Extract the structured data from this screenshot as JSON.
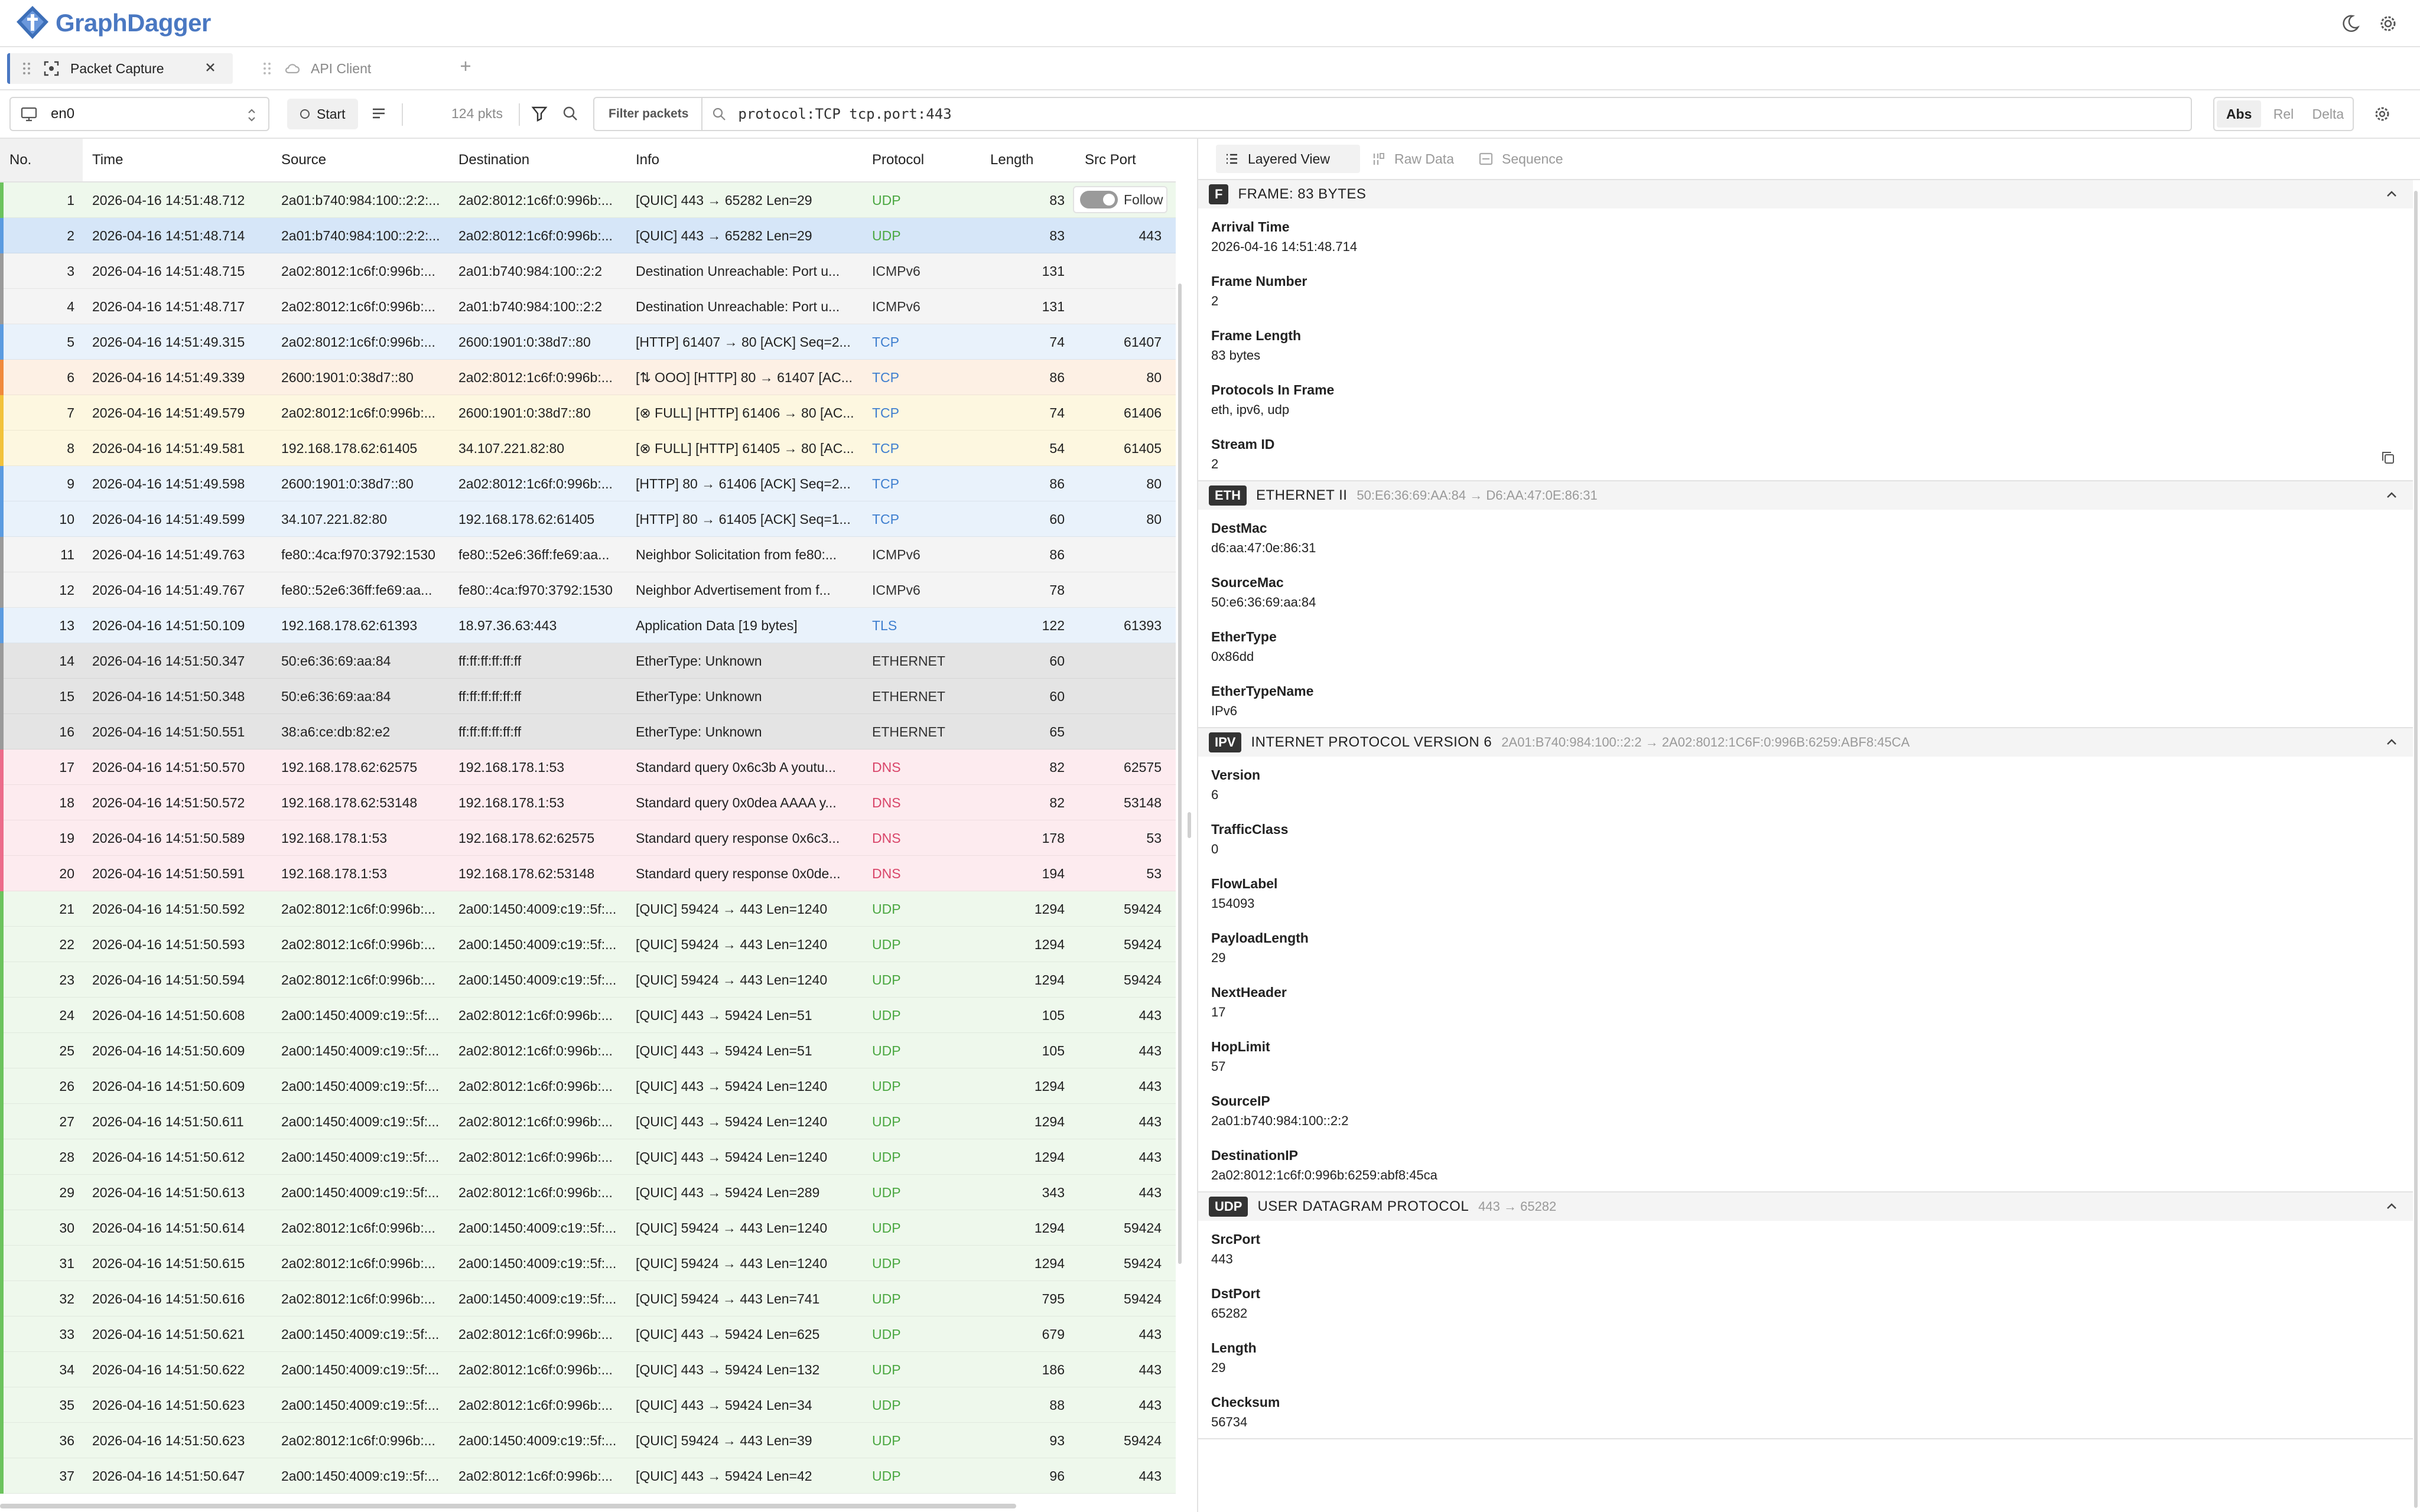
{
  "app": {
    "name": "GraphDagger"
  },
  "tabs": [
    {
      "label": "Packet Capture",
      "active": true
    },
    {
      "label": "API Client",
      "active": false
    }
  ],
  "toolbar": {
    "interface": "en0",
    "start_label": "Start",
    "packet_count": "124 pkts",
    "filter_label": "Filter packets",
    "filter_value": "protocol:TCP tcp.port:443",
    "time_modes": [
      "Abs",
      "Rel",
      "Delta"
    ],
    "time_mode_selected": "Abs"
  },
  "table": {
    "columns": {
      "no": "No.",
      "time": "Time",
      "source": "Source",
      "destination": "Destination",
      "info": "Info",
      "protocol": "Protocol",
      "length": "Length",
      "src_port": "Src Port"
    },
    "follow_label": "Follow",
    "rows": [
      {
        "no": "1",
        "time": "2026-04-16 14:51:48.712",
        "src": "2a01:b740:984:100::2:2:...",
        "dst": "2a02:8012:1c6f:0:996b:...",
        "info": "[QUIC] 443 → 65282 Len=29",
        "proto": "UDP",
        "len": "83",
        "port": "",
        "t": "udp"
      },
      {
        "no": "2",
        "time": "2026-04-16 14:51:48.714",
        "src": "2a01:b740:984:100::2:2:...",
        "dst": "2a02:8012:1c6f:0:996b:...",
        "info": "[QUIC] 443 → 65282 Len=29",
        "proto": "UDP",
        "len": "83",
        "port": "443",
        "t": "udp",
        "sel": true
      },
      {
        "no": "3",
        "time": "2026-04-16 14:51:48.715",
        "src": "2a02:8012:1c6f:0:996b:...",
        "dst": "2a01:b740:984:100::2:2",
        "info": "Destination Unreachable: Port u...",
        "proto": "ICMPv6",
        "len": "131",
        "port": "",
        "t": "icmp"
      },
      {
        "no": "4",
        "time": "2026-04-16 14:51:48.717",
        "src": "2a02:8012:1c6f:0:996b:...",
        "dst": "2a01:b740:984:100::2:2",
        "info": "Destination Unreachable: Port u...",
        "proto": "ICMPv6",
        "len": "131",
        "port": "",
        "t": "icmp"
      },
      {
        "no": "5",
        "time": "2026-04-16 14:51:49.315",
        "src": "2a02:8012:1c6f:0:996b:...",
        "dst": "2600:1901:0:38d7::80",
        "info": "[HTTP] 61407 → 80 [ACK] Seq=2...",
        "proto": "TCP",
        "len": "74",
        "port": "61407",
        "t": "tcp"
      },
      {
        "no": "6",
        "time": "2026-04-16 14:51:49.339",
        "src": "2600:1901:0:38d7::80",
        "dst": "2a02:8012:1c6f:0:996b:...",
        "info": "[⇅ OOO] [HTTP] 80 → 61407 [AC...",
        "proto": "TCP",
        "len": "86",
        "port": "80",
        "t": "ooo"
      },
      {
        "no": "7",
        "time": "2026-04-16 14:51:49.579",
        "src": "2a02:8012:1c6f:0:996b:...",
        "dst": "2600:1901:0:38d7::80",
        "info": "[⊗ FULL] [HTTP] 61406 → 80 [AC...",
        "proto": "TCP",
        "len": "74",
        "port": "61406",
        "t": "full"
      },
      {
        "no": "8",
        "time": "2026-04-16 14:51:49.581",
        "src": "192.168.178.62:61405",
        "dst": "34.107.221.82:80",
        "info": "[⊗ FULL] [HTTP] 61405 → 80 [AC...",
        "proto": "TCP",
        "len": "54",
        "port": "61405",
        "t": "full"
      },
      {
        "no": "9",
        "time": "2026-04-16 14:51:49.598",
        "src": "2600:1901:0:38d7::80",
        "dst": "2a02:8012:1c6f:0:996b:...",
        "info": "[HTTP] 80 → 61406 [ACK] Seq=2...",
        "proto": "TCP",
        "len": "86",
        "port": "80",
        "t": "tcp"
      },
      {
        "no": "10",
        "time": "2026-04-16 14:51:49.599",
        "src": "34.107.221.82:80",
        "dst": "192.168.178.62:61405",
        "info": "[HTTP] 80 → 61405 [ACK] Seq=1...",
        "proto": "TCP",
        "len": "60",
        "port": "80",
        "t": "tcp"
      },
      {
        "no": "11",
        "time": "2026-04-16 14:51:49.763",
        "src": "fe80::4ca:f970:3792:1530",
        "dst": "fe80::52e6:36ff:fe69:aa...",
        "info": "Neighbor Solicitation from fe80:...",
        "proto": "ICMPv6",
        "len": "86",
        "port": "",
        "t": "icmp"
      },
      {
        "no": "12",
        "time": "2026-04-16 14:51:49.767",
        "src": "fe80::52e6:36ff:fe69:aa...",
        "dst": "fe80::4ca:f970:3792:1530",
        "info": "Neighbor Advertisement from f...",
        "proto": "ICMPv6",
        "len": "78",
        "port": "",
        "t": "icmp"
      },
      {
        "no": "13",
        "time": "2026-04-16 14:51:50.109",
        "src": "192.168.178.62:61393",
        "dst": "18.97.36.63:443",
        "info": "Application Data [19 bytes]",
        "proto": "TLS",
        "len": "122",
        "port": "61393",
        "t": "tls"
      },
      {
        "no": "14",
        "time": "2026-04-16 14:51:50.347",
        "src": "50:e6:36:69:aa:84",
        "dst": "ff:ff:ff:ff:ff:ff",
        "info": "EtherType: Unknown",
        "proto": "ETHERNET",
        "len": "60",
        "port": "",
        "t": "eth"
      },
      {
        "no": "15",
        "time": "2026-04-16 14:51:50.348",
        "src": "50:e6:36:69:aa:84",
        "dst": "ff:ff:ff:ff:ff:ff",
        "info": "EtherType: Unknown",
        "proto": "ETHERNET",
        "len": "60",
        "port": "",
        "t": "eth"
      },
      {
        "no": "16",
        "time": "2026-04-16 14:51:50.551",
        "src": "38:a6:ce:db:82:e2",
        "dst": "ff:ff:ff:ff:ff:ff",
        "info": "EtherType: Unknown",
        "proto": "ETHERNET",
        "len": "65",
        "port": "",
        "t": "eth"
      },
      {
        "no": "17",
        "time": "2026-04-16 14:51:50.570",
        "src": "192.168.178.62:62575",
        "dst": "192.168.178.1:53",
        "info": "Standard query 0x6c3b A youtu...",
        "proto": "DNS",
        "len": "82",
        "port": "62575",
        "t": "dns"
      },
      {
        "no": "18",
        "time": "2026-04-16 14:51:50.572",
        "src": "192.168.178.62:53148",
        "dst": "192.168.178.1:53",
        "info": "Standard query 0x0dea AAAA y...",
        "proto": "DNS",
        "len": "82",
        "port": "53148",
        "t": "dns"
      },
      {
        "no": "19",
        "time": "2026-04-16 14:51:50.589",
        "src": "192.168.178.1:53",
        "dst": "192.168.178.62:62575",
        "info": "Standard query response 0x6c3...",
        "proto": "DNS",
        "len": "178",
        "port": "53",
        "t": "dns"
      },
      {
        "no": "20",
        "time": "2026-04-16 14:51:50.591",
        "src": "192.168.178.1:53",
        "dst": "192.168.178.62:53148",
        "info": "Standard query response 0x0de...",
        "proto": "DNS",
        "len": "194",
        "port": "53",
        "t": "dns"
      },
      {
        "no": "21",
        "time": "2026-04-16 14:51:50.592",
        "src": "2a02:8012:1c6f:0:996b:...",
        "dst": "2a00:1450:4009:c19::5f:...",
        "info": "[QUIC] 59424 → 443 Len=1240",
        "proto": "UDP",
        "len": "1294",
        "port": "59424",
        "t": "udp"
      },
      {
        "no": "22",
        "time": "2026-04-16 14:51:50.593",
        "src": "2a02:8012:1c6f:0:996b:...",
        "dst": "2a00:1450:4009:c19::5f:...",
        "info": "[QUIC] 59424 → 443 Len=1240",
        "proto": "UDP",
        "len": "1294",
        "port": "59424",
        "t": "udp"
      },
      {
        "no": "23",
        "time": "2026-04-16 14:51:50.594",
        "src": "2a02:8012:1c6f:0:996b:...",
        "dst": "2a00:1450:4009:c19::5f:...",
        "info": "[QUIC] 59424 → 443 Len=1240",
        "proto": "UDP",
        "len": "1294",
        "port": "59424",
        "t": "udp"
      },
      {
        "no": "24",
        "time": "2026-04-16 14:51:50.608",
        "src": "2a00:1450:4009:c19::5f:...",
        "dst": "2a02:8012:1c6f:0:996b:...",
        "info": "[QUIC] 443 → 59424 Len=51",
        "proto": "UDP",
        "len": "105",
        "port": "443",
        "t": "udp"
      },
      {
        "no": "25",
        "time": "2026-04-16 14:51:50.609",
        "src": "2a00:1450:4009:c19::5f:...",
        "dst": "2a02:8012:1c6f:0:996b:...",
        "info": "[QUIC] 443 → 59424 Len=51",
        "proto": "UDP",
        "len": "105",
        "port": "443",
        "t": "udp"
      },
      {
        "no": "26",
        "time": "2026-04-16 14:51:50.609",
        "src": "2a00:1450:4009:c19::5f:...",
        "dst": "2a02:8012:1c6f:0:996b:...",
        "info": "[QUIC] 443 → 59424 Len=1240",
        "proto": "UDP",
        "len": "1294",
        "port": "443",
        "t": "udp"
      },
      {
        "no": "27",
        "time": "2026-04-16 14:51:50.611",
        "src": "2a00:1450:4009:c19::5f:...",
        "dst": "2a02:8012:1c6f:0:996b:...",
        "info": "[QUIC] 443 → 59424 Len=1240",
        "proto": "UDP",
        "len": "1294",
        "port": "443",
        "t": "udp"
      },
      {
        "no": "28",
        "time": "2026-04-16 14:51:50.612",
        "src": "2a00:1450:4009:c19::5f:...",
        "dst": "2a02:8012:1c6f:0:996b:...",
        "info": "[QUIC] 443 → 59424 Len=1240",
        "proto": "UDP",
        "len": "1294",
        "port": "443",
        "t": "udp"
      },
      {
        "no": "29",
        "time": "2026-04-16 14:51:50.613",
        "src": "2a00:1450:4009:c19::5f:...",
        "dst": "2a02:8012:1c6f:0:996b:...",
        "info": "[QUIC] 443 → 59424 Len=289",
        "proto": "UDP",
        "len": "343",
        "port": "443",
        "t": "udp"
      },
      {
        "no": "30",
        "time": "2026-04-16 14:51:50.614",
        "src": "2a02:8012:1c6f:0:996b:...",
        "dst": "2a00:1450:4009:c19::5f:...",
        "info": "[QUIC] 59424 → 443 Len=1240",
        "proto": "UDP",
        "len": "1294",
        "port": "59424",
        "t": "udp"
      },
      {
        "no": "31",
        "time": "2026-04-16 14:51:50.615",
        "src": "2a02:8012:1c6f:0:996b:...",
        "dst": "2a00:1450:4009:c19::5f:...",
        "info": "[QUIC] 59424 → 443 Len=1240",
        "proto": "UDP",
        "len": "1294",
        "port": "59424",
        "t": "udp"
      },
      {
        "no": "32",
        "time": "2026-04-16 14:51:50.616",
        "src": "2a02:8012:1c6f:0:996b:...",
        "dst": "2a00:1450:4009:c19::5f:...",
        "info": "[QUIC] 59424 → 443 Len=741",
        "proto": "UDP",
        "len": "795",
        "port": "59424",
        "t": "udp"
      },
      {
        "no": "33",
        "time": "2026-04-16 14:51:50.621",
        "src": "2a00:1450:4009:c19::5f:...",
        "dst": "2a02:8012:1c6f:0:996b:...",
        "info": "[QUIC] 443 → 59424 Len=625",
        "proto": "UDP",
        "len": "679",
        "port": "443",
        "t": "udp"
      },
      {
        "no": "34",
        "time": "2026-04-16 14:51:50.622",
        "src": "2a00:1450:4009:c19::5f:...",
        "dst": "2a02:8012:1c6f:0:996b:...",
        "info": "[QUIC] 443 → 59424 Len=132",
        "proto": "UDP",
        "len": "186",
        "port": "443",
        "t": "udp"
      },
      {
        "no": "35",
        "time": "2026-04-16 14:51:50.623",
        "src": "2a00:1450:4009:c19::5f:...",
        "dst": "2a02:8012:1c6f:0:996b:...",
        "info": "[QUIC] 443 → 59424 Len=34",
        "proto": "UDP",
        "len": "88",
        "port": "443",
        "t": "udp"
      },
      {
        "no": "36",
        "time": "2026-04-16 14:51:50.623",
        "src": "2a02:8012:1c6f:0:996b:...",
        "dst": "2a00:1450:4009:c19::5f:...",
        "info": "[QUIC] 59424 → 443 Len=39",
        "proto": "UDP",
        "len": "93",
        "port": "59424",
        "t": "udp"
      },
      {
        "no": "37",
        "time": "2026-04-16 14:51:50.647",
        "src": "2a00:1450:4009:c19::5f:...",
        "dst": "2a02:8012:1c6f:0:996b:...",
        "info": "[QUIC] 443 → 59424 Len=42",
        "proto": "UDP",
        "len": "96",
        "port": "443",
        "t": "udp"
      }
    ]
  },
  "row_styles": {
    "udp": {
      "bg": "#eef8ec",
      "bar": "#6cc35d",
      "proto": "#4ca843"
    },
    "icmp": {
      "bg": "#f4f4f4",
      "bar": "#9a9a9a",
      "proto": "#333333"
    },
    "tcp": {
      "bg": "#e9f2fb",
      "bar": "#5b9be0",
      "proto": "#3f7fcf"
    },
    "ooo": {
      "bg": "#fdf0e4",
      "bar": "#f08a3c",
      "proto": "#3f7fcf"
    },
    "full": {
      "bg": "#fdf7e0",
      "bar": "#f2c23b",
      "proto": "#3f7fcf"
    },
    "tls": {
      "bg": "#e9f2fb",
      "bar": "#5b9be0",
      "proto": "#3f7fcf"
    },
    "eth": {
      "bg": "#e4e4e4",
      "bar": "#9a9a9a",
      "proto": "#333333"
    },
    "dns": {
      "bg": "#fdebef",
      "bar": "#ec6c8a",
      "proto": "#d9466a"
    },
    "selected": {
      "bg": "#d6e6f8",
      "bar": "#5b9be0"
    }
  },
  "detail": {
    "tabs": [
      "Layered View",
      "Raw Data",
      "Sequence"
    ],
    "selected_tab": "Layered View",
    "sections": [
      {
        "badge": "F",
        "title": "FRAME: 83 BYTES",
        "subtitle": "",
        "fields": [
          {
            "name": "Arrival Time",
            "value": "2026-04-16 14:51:48.714"
          },
          {
            "name": "Frame Number",
            "value": "2"
          },
          {
            "name": "Frame Length",
            "value": "83 bytes"
          },
          {
            "name": "Protocols In Frame",
            "value": "eth, ipv6, udp"
          },
          {
            "name": "Stream ID",
            "value": "2",
            "copy": true
          }
        ]
      },
      {
        "badge": "ETH",
        "title": "ETHERNET II",
        "subtitle": "50:E6:36:69:AA:84 → D6:AA:47:0E:86:31",
        "fields": [
          {
            "name": "DestMac",
            "value": "d6:aa:47:0e:86:31"
          },
          {
            "name": "SourceMac",
            "value": "50:e6:36:69:aa:84"
          },
          {
            "name": "EtherType",
            "value": "0x86dd"
          },
          {
            "name": "EtherTypeName",
            "value": "IPv6"
          }
        ]
      },
      {
        "badge": "IPV",
        "title": "INTERNET PROTOCOL VERSION 6",
        "subtitle": "2A01:B740:984:100::2:2 → 2A02:8012:1C6F:0:996B:6259:ABF8:45CA",
        "fields": [
          {
            "name": "Version",
            "value": "6"
          },
          {
            "name": "TrafficClass",
            "value": "0"
          },
          {
            "name": "FlowLabel",
            "value": "154093"
          },
          {
            "name": "PayloadLength",
            "value": "29"
          },
          {
            "name": "NextHeader",
            "value": "17"
          },
          {
            "name": "HopLimit",
            "value": "57"
          },
          {
            "name": "SourceIP",
            "value": "2a01:b740:984:100::2:2"
          },
          {
            "name": "DestinationIP",
            "value": "2a02:8012:1c6f:0:996b:6259:abf8:45ca"
          }
        ]
      },
      {
        "badge": "UDP",
        "title": "USER DATAGRAM PROTOCOL",
        "subtitle": "443 → 65282",
        "fields": [
          {
            "name": "SrcPort",
            "value": "443"
          },
          {
            "name": "DstPort",
            "value": "65282"
          },
          {
            "name": "Length",
            "value": "29"
          },
          {
            "name": "Checksum",
            "value": "56734"
          }
        ]
      }
    ]
  }
}
